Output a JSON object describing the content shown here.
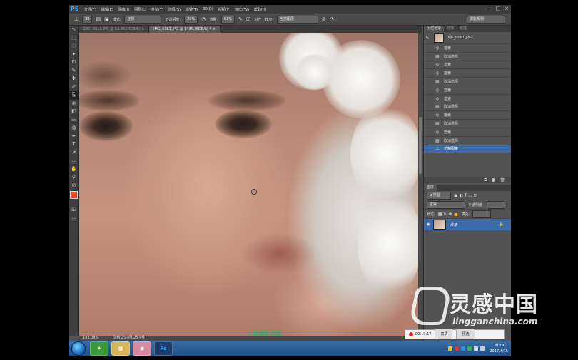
{
  "app": {
    "logo": "PS",
    "menu": [
      "文件(F)",
      "编辑(E)",
      "图像(I)",
      "图层(L)",
      "类型(Y)",
      "选择(S)",
      "滤镜(T)",
      "3D(D)",
      "视图(V)",
      "窗口(W)",
      "帮助(H)"
    ],
    "window_controls": [
      "–",
      "□",
      "×"
    ]
  },
  "options": {
    "brush_size": "30",
    "mode_label": "模式:",
    "mode_value": "正常",
    "opacity_label": "不透明度:",
    "opacity_value": "29%",
    "flow_label": "流量:",
    "flow_value": "61%",
    "aligned_label": "对齐",
    "sample_label": "样本:",
    "sample_value": "当前图层",
    "workspace": "摄影规则"
  },
  "doc_tabs": [
    {
      "label": "DSC_0013.JPG @ 53.8%(RGB/8) ×",
      "active": false
    },
    {
      "label": "IMG_6061.JPG @ 143%(RGB/8) * ×",
      "active": true
    }
  ],
  "tools": [
    "↖",
    "⬚",
    "◌",
    "✦",
    "⊡",
    "✎",
    "✚",
    "✐",
    "⎘",
    "⊕",
    "◧",
    "▭",
    "◍",
    "✒",
    "T",
    "↗",
    "▭",
    "✋",
    "⚲",
    "⊙"
  ],
  "colors": {
    "foreground": "#e8501f",
    "background": "#000000",
    "selection": "#3d6aa8",
    "accent": "#39a6ff"
  },
  "canvas": {
    "watermark": "小猪摄影课堂"
  },
  "status": {
    "zoom": "143.08%",
    "doc": "文档:25.4M/25.4M"
  },
  "history_panel": {
    "tabs": [
      "历史记录",
      "动作",
      "属性"
    ],
    "snapshot": "IMG_6061.JPG",
    "items": [
      {
        "icon": "lasso-icon",
        "label": "套索"
      },
      {
        "icon": "doc-icon",
        "label": "取消选择"
      },
      {
        "icon": "lasso-icon",
        "label": "套索"
      },
      {
        "icon": "lasso-icon",
        "label": "套索"
      },
      {
        "icon": "doc-icon",
        "label": "取消选择"
      },
      {
        "icon": "lasso-icon",
        "label": "套索"
      },
      {
        "icon": "lasso-icon",
        "label": "套索"
      },
      {
        "icon": "doc-icon",
        "label": "取消选择"
      },
      {
        "icon": "lasso-icon",
        "label": "套索"
      },
      {
        "icon": "doc-icon",
        "label": "取消选择"
      },
      {
        "icon": "lasso-icon",
        "label": "套索"
      },
      {
        "icon": "doc-icon",
        "label": "取消选择"
      },
      {
        "icon": "stamp-icon",
        "label": "仿制图章",
        "selected": true
      }
    ]
  },
  "layers_panel": {
    "tab": "图层",
    "kind": "ρ 类型",
    "blend": "正常",
    "opacity_label": "不透明度:",
    "lock_label": "锁定:",
    "fill_label": "填充:",
    "layer_name": "背景"
  },
  "brand": {
    "cn": "灵感中国",
    "url": "lingganchina.com"
  },
  "recorder": {
    "time": "00:19:17",
    "btn1": "高清",
    "btn2": "预选"
  },
  "taskbar": {
    "apps": [
      "✦",
      "▦",
      "◉",
      "Ps"
    ],
    "time": "20:19",
    "date": "2017/4/15"
  }
}
